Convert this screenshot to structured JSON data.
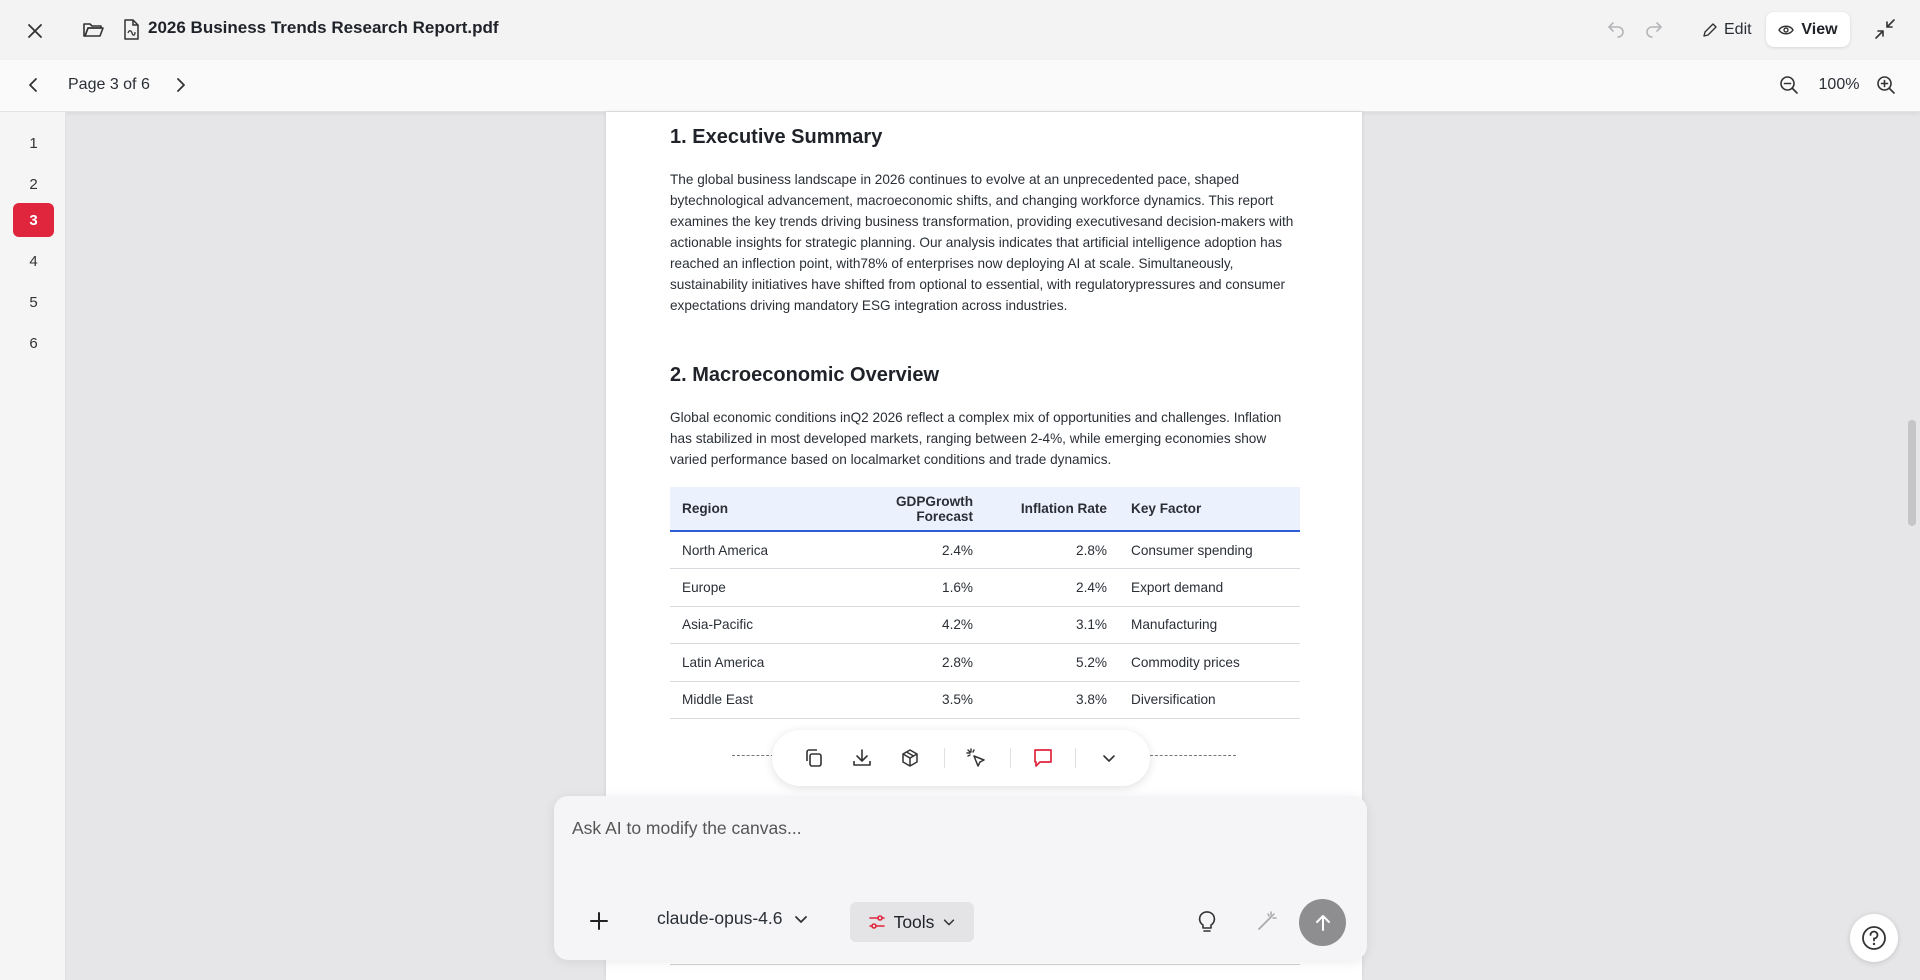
{
  "window": {
    "title": "2026 Business Trends Research Report.pdf",
    "edit_label": "Edit",
    "view_label": "View"
  },
  "nav": {
    "page_indicator": "Page 3 of 6",
    "zoom": "100%"
  },
  "thumbnails": {
    "pages": [
      "1",
      "2",
      "3",
      "4",
      "5",
      "6"
    ],
    "active_page": "3"
  },
  "document": {
    "section1": {
      "heading": "1. Executive Summary",
      "lines": [
        "The global business landscape in 2026 continues to evolve at an unprecedented pace, shaped",
        "bytechnological advancement, macroeconomic shifts, and changing workforce dynamics. This report",
        "examines the key trends driving business transformation, providing executivesand decision-makers with",
        "actionable insights for strategic planning. Our analysis indicates that artificial intelligence adoption has",
        "reached an inflection point, with78% of enterprises now deploying AI at scale. Simultaneously,",
        "sustainability initiatives have shifted from optional to essential, with regulatorypressures and consumer",
        "expectations driving mandatory ESG integration across industries."
      ]
    },
    "section2": {
      "heading": "2. Macroeconomic Overview",
      "lines": [
        "Global economic conditions inQ2 2026 reflect a complex mix of opportunities and challenges. Inflation",
        "has stabilized in most developed markets, ranging between 2-4%, while emerging economies show",
        "varied performance based on localmarket conditions and trade dynamics."
      ]
    },
    "table": {
      "headers": [
        "Region",
        "GDPGrowth Forecast",
        "Inflation Rate",
        "Key Factor"
      ],
      "rows": [
        [
          "North America",
          "2.4%",
          "2.8%",
          "Consumer spending"
        ],
        [
          "Europe",
          "1.6%",
          "2.4%",
          "Export demand"
        ],
        [
          "Asia-Pacific",
          "4.2%",
          "3.1%",
          "Manufacturing"
        ],
        [
          "Latin America",
          "2.8%",
          "5.2%",
          "Commodity prices"
        ],
        [
          "Middle East",
          "3.5%",
          "3.8%",
          "Diversification"
        ]
      ]
    }
  },
  "floating_toolbar": {
    "icons": [
      "copy-icon",
      "download-icon",
      "cube-icon",
      "pointer-sparkle-icon",
      "comment-icon",
      "chevron-down-icon"
    ],
    "accent": "#e0263c"
  },
  "ai_panel": {
    "placeholder": "Ask AI to modify the canvas...",
    "model": "claude-opus-4.6",
    "tools_label": "Tools"
  },
  "colors": {
    "accent_red": "#e0263c",
    "table_header_bg": "#ecf2fd",
    "table_header_rule": "#2d5ed8"
  }
}
